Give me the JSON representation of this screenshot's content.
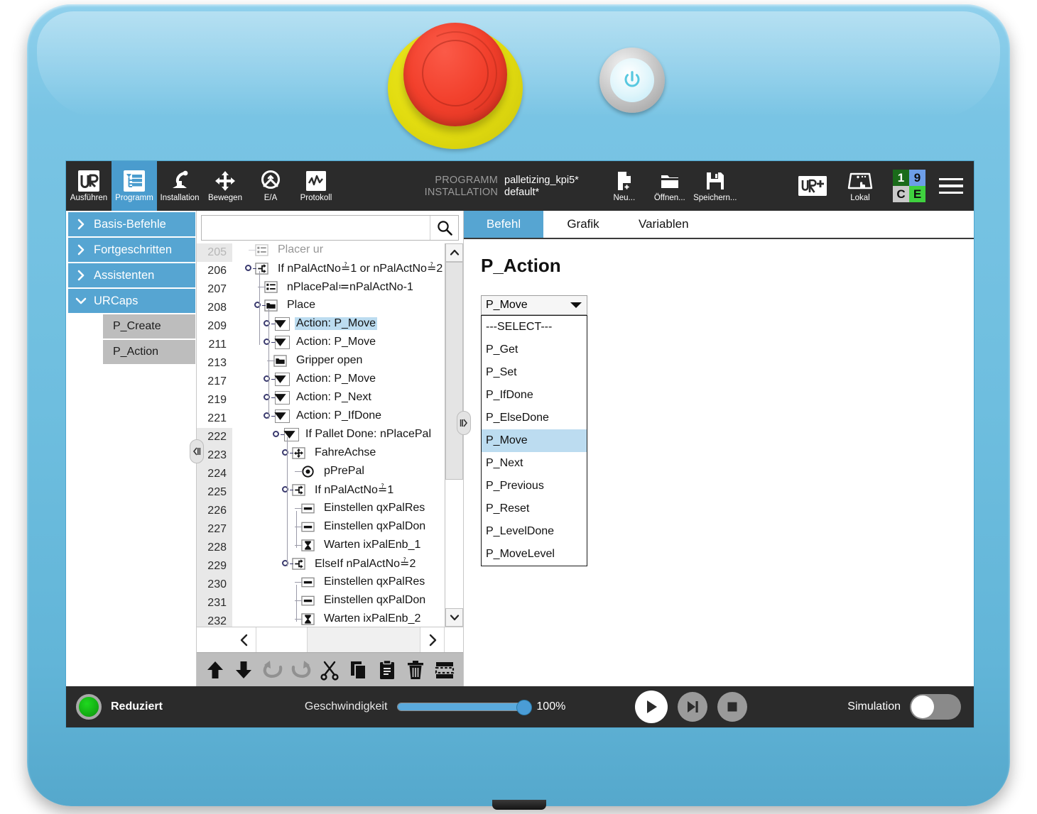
{
  "device": {
    "estop_name": "emergency-stop-button",
    "power_name": "power-button",
    "shell_color": "#6ebedf"
  },
  "header": {
    "tabs": [
      {
        "label": "Ausführen",
        "icon": "ur-logo-icon",
        "active": false
      },
      {
        "label": "Programm",
        "icon": "program-tree-icon",
        "active": true
      },
      {
        "label": "Installation",
        "icon": "robot-arm-icon",
        "active": false
      },
      {
        "label": "Bewegen",
        "icon": "move-arrows-icon",
        "active": false
      },
      {
        "label": "E/A",
        "icon": "io-icon",
        "active": false
      },
      {
        "label": "Protokoll",
        "icon": "log-waveform-icon",
        "active": false
      }
    ],
    "program_key": "PROGRAMM",
    "program_value": "palletizing_kpi5*",
    "installation_key": "INSTALLATION",
    "installation_value": "default*",
    "file_ops": [
      {
        "label": "Neu...",
        "icon": "new-file-icon"
      },
      {
        "label": "Öffnen...",
        "icon": "open-folder-icon"
      },
      {
        "label": "Speichern...",
        "icon": "save-floppy-icon"
      }
    ],
    "urplus_icon": "ur-plus-icon",
    "lokal_label": "Lokal",
    "lokal_icon": "local-control-icon",
    "status_cells": [
      {
        "text": "1",
        "bg": "#1a6b1a",
        "fg": "#ffffff"
      },
      {
        "text": "9",
        "bg": "#6d9ee8",
        "fg": "#0d0d0d"
      },
      {
        "text": "C",
        "bg": "#c9c9c9",
        "fg": "#0d0d0d"
      },
      {
        "text": "E",
        "bg": "#3fd13f",
        "fg": "#0d0d0d"
      }
    ],
    "menu_icon": "hamburger-menu-icon"
  },
  "sidebar": {
    "groups": [
      {
        "label": "Basis-Befehle",
        "expanded": false
      },
      {
        "label": "Fortgeschritten",
        "expanded": false
      },
      {
        "label": "Assistenten",
        "expanded": false
      },
      {
        "label": "URCaps",
        "expanded": true
      }
    ],
    "urcaps_children": [
      {
        "label": "P_Create"
      },
      {
        "label": "P_Action"
      }
    ]
  },
  "search": {
    "value": "",
    "placeholder": "",
    "icon": "search-icon"
  },
  "tree": {
    "rows": [
      {
        "line": "205",
        "text": "Placer ur",
        "icon": "assign-icon",
        "indent": 1,
        "partial": true,
        "shaded": true
      },
      {
        "line": "206",
        "text": "If nPalActNo≟1 or nPalActNo≟2",
        "icon": "if-branch-icon",
        "indent": 1,
        "pin": true
      },
      {
        "line": "207",
        "text": "nPlacePal≔nPalActNo-1",
        "icon": "assign-icon",
        "indent": 2
      },
      {
        "line": "208",
        "text": "Place",
        "icon": "folder-icon",
        "indent": 2,
        "pin": true
      },
      {
        "line": "209",
        "text": "Action: P_Move",
        "icon": "dropdown-box-icon",
        "indent": 3,
        "pin": true,
        "selected": true
      },
      {
        "line": "211",
        "text": "Action: P_Move",
        "icon": "dropdown-box-icon",
        "indent": 3,
        "pin": true
      },
      {
        "line": "213",
        "text": "Gripper open",
        "icon": "folder-icon",
        "indent": 3
      },
      {
        "line": "217",
        "text": "Action: P_Move",
        "icon": "dropdown-box-icon",
        "indent": 3,
        "pin": true
      },
      {
        "line": "219",
        "text": "Action: P_Next",
        "icon": "dropdown-box-icon",
        "indent": 3,
        "pin": true
      },
      {
        "line": "221",
        "text": "Action: P_IfDone",
        "icon": "dropdown-box-icon",
        "indent": 3,
        "pin": true
      },
      {
        "line": "222",
        "text": "If Pallet Done: nPlacePal",
        "icon": "dropdown-box-icon",
        "indent": 4,
        "pin": true,
        "shaded": true
      },
      {
        "line": "223",
        "text": "FahreAchse",
        "icon": "move-axis-icon",
        "indent": 5,
        "pin": true,
        "shaded": true
      },
      {
        "line": "224",
        "text": "pPrePal",
        "icon": "waypoint-icon",
        "indent": 6,
        "shaded": true
      },
      {
        "line": "225",
        "text": "If nPalActNo≟1",
        "icon": "if-branch-icon",
        "indent": 5,
        "pin": true,
        "shaded": true
      },
      {
        "line": "226",
        "text": "Einstellen qxPalRes",
        "icon": "set-io-icon",
        "indent": 6,
        "shaded": true
      },
      {
        "line": "227",
        "text": "Einstellen qxPalDon",
        "icon": "set-io-icon",
        "indent": 6,
        "shaded": true
      },
      {
        "line": "228",
        "text": "Warten ixPalEnb_1",
        "icon": "wait-hourglass-icon",
        "indent": 6,
        "shaded": true
      },
      {
        "line": "229",
        "text": "ElseIf nPalActNo≟2",
        "icon": "if-branch-icon",
        "indent": 5,
        "pin": true,
        "shaded": true
      },
      {
        "line": "230",
        "text": "Einstellen qxPalRes",
        "icon": "set-io-icon",
        "indent": 6,
        "shaded": true
      },
      {
        "line": "231",
        "text": "Einstellen qxPalDon",
        "icon": "set-io-icon",
        "indent": 6,
        "shaded": true
      },
      {
        "line": "232",
        "text": "Warten ixPalEnb_2",
        "icon": "wait-hourglass-icon",
        "indent": 6,
        "shaded": true
      }
    ],
    "scrollbar": {
      "up_icon": "chevron-up-icon",
      "down_icon": "chevron-down-icon",
      "thumb_percent": 63
    },
    "paging": {
      "prev_icon": "chevron-left-icon",
      "next_icon": "chevron-right-icon"
    }
  },
  "edit_toolbar": {
    "buttons": [
      {
        "name": "move-up-button",
        "icon": "arrow-up-icon",
        "disabled": false
      },
      {
        "name": "move-down-button",
        "icon": "arrow-down-icon",
        "disabled": false
      },
      {
        "name": "undo-button",
        "icon": "undo-arrow-icon",
        "disabled": true
      },
      {
        "name": "redo-button",
        "icon": "redo-arrow-icon",
        "disabled": true
      },
      {
        "name": "cut-button",
        "icon": "scissors-icon",
        "disabled": false
      },
      {
        "name": "copy-button",
        "icon": "copy-pages-icon",
        "disabled": false
      },
      {
        "name": "paste-button",
        "icon": "clipboard-paste-icon",
        "disabled": false
      },
      {
        "name": "delete-button",
        "icon": "trash-can-icon",
        "disabled": false
      },
      {
        "name": "suppress-button",
        "icon": "suppress-block-icon",
        "disabled": false
      }
    ]
  },
  "right_panel": {
    "tabs": [
      {
        "label": "Befehl",
        "active": true
      },
      {
        "label": "Grafik",
        "active": false
      },
      {
        "label": "Variablen",
        "active": false
      }
    ],
    "title": "P_Action",
    "combo": {
      "selected": "P_Move",
      "arrow_icon": "chevron-down-icon",
      "open": true,
      "options": [
        "---SELECT---",
        "P_Get",
        "P_Set",
        "P_IfDone",
        "P_ElseDone",
        "P_Move",
        "P_Next",
        "P_Previous",
        "P_Reset",
        "P_LevelDone",
        "P_MoveLevel"
      ]
    }
  },
  "footer": {
    "state_label": "Reduziert",
    "state_color": "#12a812",
    "speed_label": "Geschwindigkeit",
    "speed_value": "100%",
    "speed_percent": 100,
    "play_icon": "play-triangle-icon",
    "step_icon": "step-forward-icon",
    "stop_icon": "stop-square-icon",
    "simulation_label": "Simulation",
    "simulation_on": false
  }
}
